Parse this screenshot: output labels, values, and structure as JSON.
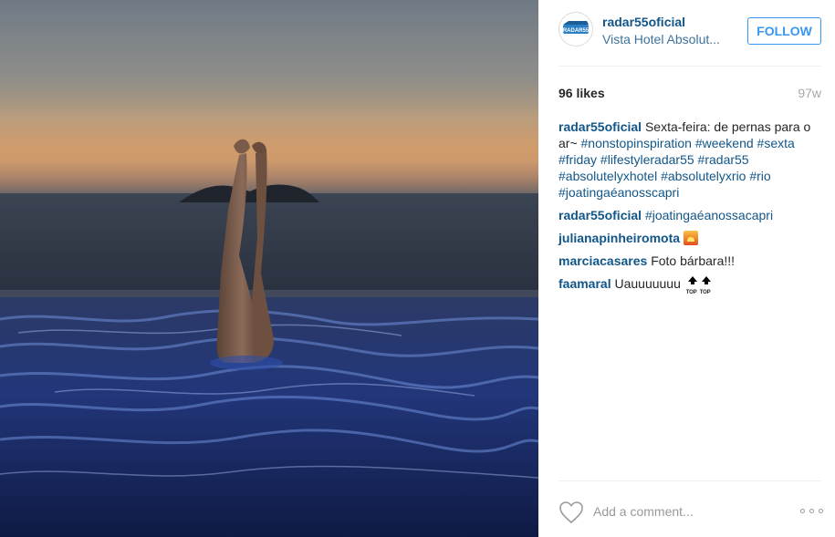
{
  "post": {
    "username": "radar55oficial",
    "location": "Vista Hotel Absolut...",
    "follow_label": "FOLLOW",
    "avatar_logo_text": "RADAR55",
    "likes": "96 likes",
    "time_ago": "97w"
  },
  "comments": [
    {
      "user": "radar55oficial",
      "text": "Sexta-feira: de pernas para o ar~",
      "tags": [
        "#nonstopinspiration",
        "#weekend",
        "#sexta",
        "#friday",
        "#lifestyleradar55",
        "#radar55",
        "#absolutelyxhotel",
        "#absolutelyxrio",
        "#rio",
        "#joatingaéanosscapri"
      ]
    },
    {
      "user": "radar55oficial",
      "text": "",
      "tags": [
        "#joatingaéanossacapri"
      ]
    },
    {
      "user": "julianapinheiromota",
      "text": "",
      "emoji": "sunset-emoji"
    },
    {
      "user": "marciacasares",
      "text": "Foto bárbara!!!"
    },
    {
      "user": "faamaral",
      "text": "Uauuuuuuu",
      "emoji": "top-emoji",
      "emoji_text": "TOP"
    }
  ],
  "footer": {
    "add_comment_placeholder": "Add a comment...",
    "like_icon": "heart-icon",
    "more_icon": "more-options-icon"
  },
  "colors": {
    "link": "#125688",
    "follow": "#3897f0",
    "muted": "#a5a7aa"
  }
}
